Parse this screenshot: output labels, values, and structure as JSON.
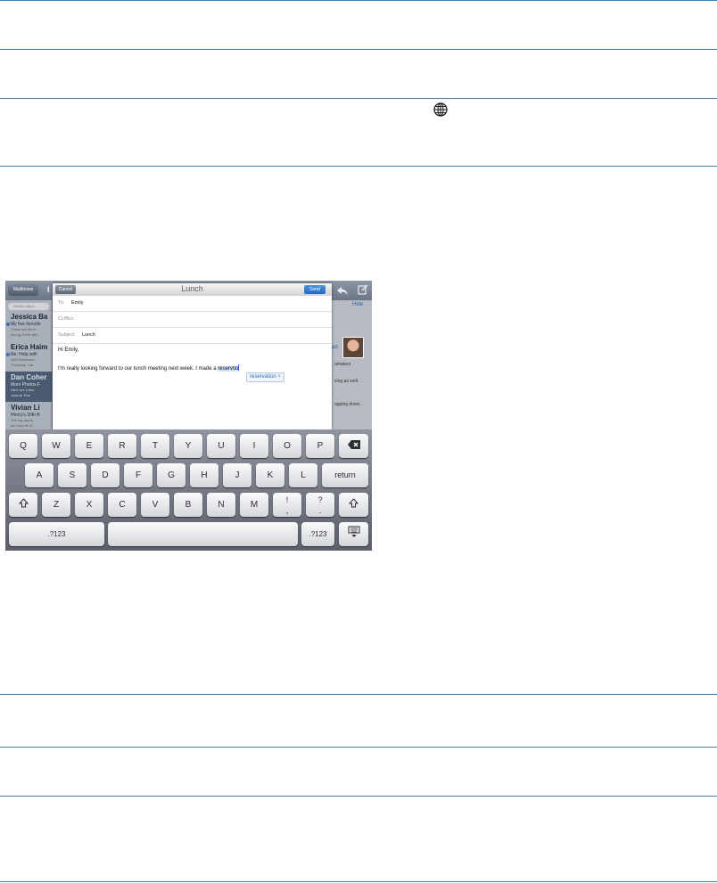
{
  "colors": {
    "rule": "#3d7fb3",
    "send": "#2568c0",
    "link": "#2c5fa8"
  },
  "icons": {
    "globe": "globe-icon",
    "reply": "reply-icon",
    "compose": "compose-icon",
    "delete": "delete-key-icon",
    "shift": "shift-icon",
    "hide_keyboard": "hide-keyboard-icon"
  },
  "background_app": {
    "mailboxes_label": "Mailboxes",
    "title_fragment": "I",
    "search_placeholder": "Search Inbox",
    "hide_label": "Hide",
    "read_fragment": "ad",
    "detail_lines": [
      "amateur",
      "ving as well.",
      "opping down."
    ],
    "messages": [
      {
        "sender": "Jessica Ba",
        "subject": "My five favorite",
        "preview": "These are the fi",
        "preview2": "wrong. Even with"
      },
      {
        "sender": "Erica Haim",
        "subject": "Re: Help with",
        "preview": "John Wednesd",
        "preview2": "Thursday. I ne"
      },
      {
        "sender": "Dan Coher",
        "subject": "More Photos F",
        "preview": "Here are a few",
        "preview2": "Joshua Tree"
      },
      {
        "sender": "Vivian Li",
        "subject": "Henry's 30th B",
        "preview": "The big day is",
        "preview2": "we have all of"
      }
    ]
  },
  "compose": {
    "cancel_label": "Cancel",
    "title": "Lunch",
    "send_label": "Send",
    "to_label": "To:",
    "to_value": "Emily",
    "ccbcc_label": "Cc/Bcc:",
    "subject_label": "Subject:",
    "subject_value": "Lunch",
    "greeting": "Hi Emily,",
    "body_before": "I'm really looking forward to our lunch meeting next week. I made a ",
    "body_typed": "reservtio",
    "suggestion": "reservation",
    "suggestion_close": "×"
  },
  "keyboard": {
    "row1": [
      "Q",
      "W",
      "E",
      "R",
      "T",
      "Y",
      "U",
      "I",
      "O",
      "P"
    ],
    "row2": [
      "A",
      "S",
      "D",
      "F",
      "G",
      "H",
      "J",
      "K",
      "L"
    ],
    "return_label": "return",
    "row3": [
      "Z",
      "X",
      "C",
      "V",
      "B",
      "N",
      "M"
    ],
    "excl": {
      "top": "!",
      "bottom": ","
    },
    "quest": {
      "top": "?",
      "bottom": "."
    },
    "numbers_label": ".?123"
  }
}
